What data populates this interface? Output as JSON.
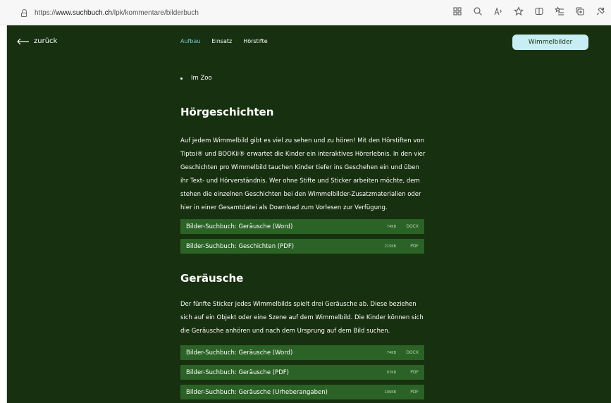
{
  "browser": {
    "url_prefix": "https://",
    "url_host": "www.suchbuch.ch",
    "url_path": "/lpk/kommentare/bilderbuch"
  },
  "header": {
    "back_label": "zurück",
    "nav": [
      {
        "label": "Aufbau",
        "active": true
      },
      {
        "label": "Einsatz",
        "active": false
      },
      {
        "label": "Hörstifte",
        "active": false
      }
    ],
    "button_label": "Wimmelbilder"
  },
  "colors": {
    "page_bg": "#17300f",
    "accent": "#79c6d8",
    "button_bg": "#c7eef4",
    "row_bg": "#2b6226"
  },
  "content": {
    "bullet_item": "Im Zoo",
    "section1": {
      "title": "Hörgeschichten",
      "paragraph": "Auf jedem Wimmelbild gibt es viel zu sehen und zu hören! Mit den Hörstiften von Tiptoi® und BOOKii® erwartet die Kinder ein interaktives Hörerlebnis. In den vier Geschichten pro Wimmelbild tauchen Kinder tiefer ins Geschehen ein und üben ihr Text- und Hörverständnis. Wer ohne Stifte und Sticker arbeiten möchte, dem stehen die einzelnen Geschichten bei den Wimmelbilder-Zusatzmaterialien oder hier in einer Gesamtdatei als Download zum Vorlesen zur Verfügung.",
      "downloads": [
        {
          "title": "Bilder-Suchbuch: Geräusche (Word)",
          "size": "74KB",
          "type": "DOCX"
        },
        {
          "title": "Bilder-Suchbuch: Geschichten (PDF)",
          "size": "215KB",
          "type": "PDF"
        }
      ]
    },
    "section2": {
      "title": "Geräusche",
      "paragraph": "Der fünfte Sticker jedes Wimmelbilds spielt drei Geräusche ab. Diese beziehen sich auf ein Objekt oder eine Szene auf dem Wimmelbild. Die Kinder können sich die Geräusche anhören und nach dem Ursprung auf dem Bild suchen.",
      "downloads": [
        {
          "title": "Bilder-Suchbuch: Geräusche (Word)",
          "size": "74KB",
          "type": "DOCX"
        },
        {
          "title": "Bilder-Suchbuch: Geräusche (PDF)",
          "size": "87KB",
          "type": "PDF"
        },
        {
          "title": "Bilder-Suchbuch: Geräusche (Urheberangaben)",
          "size": "106KB",
          "type": "PDF"
        }
      ]
    }
  },
  "icons": [
    "lock-icon",
    "arrow-left-icon",
    "grid-icon",
    "zoom-icon",
    "read-aloud-icon",
    "favorite-icon",
    "split-screen-icon",
    "favorites-bar-icon",
    "collections-icon",
    "extensions-icon"
  ]
}
